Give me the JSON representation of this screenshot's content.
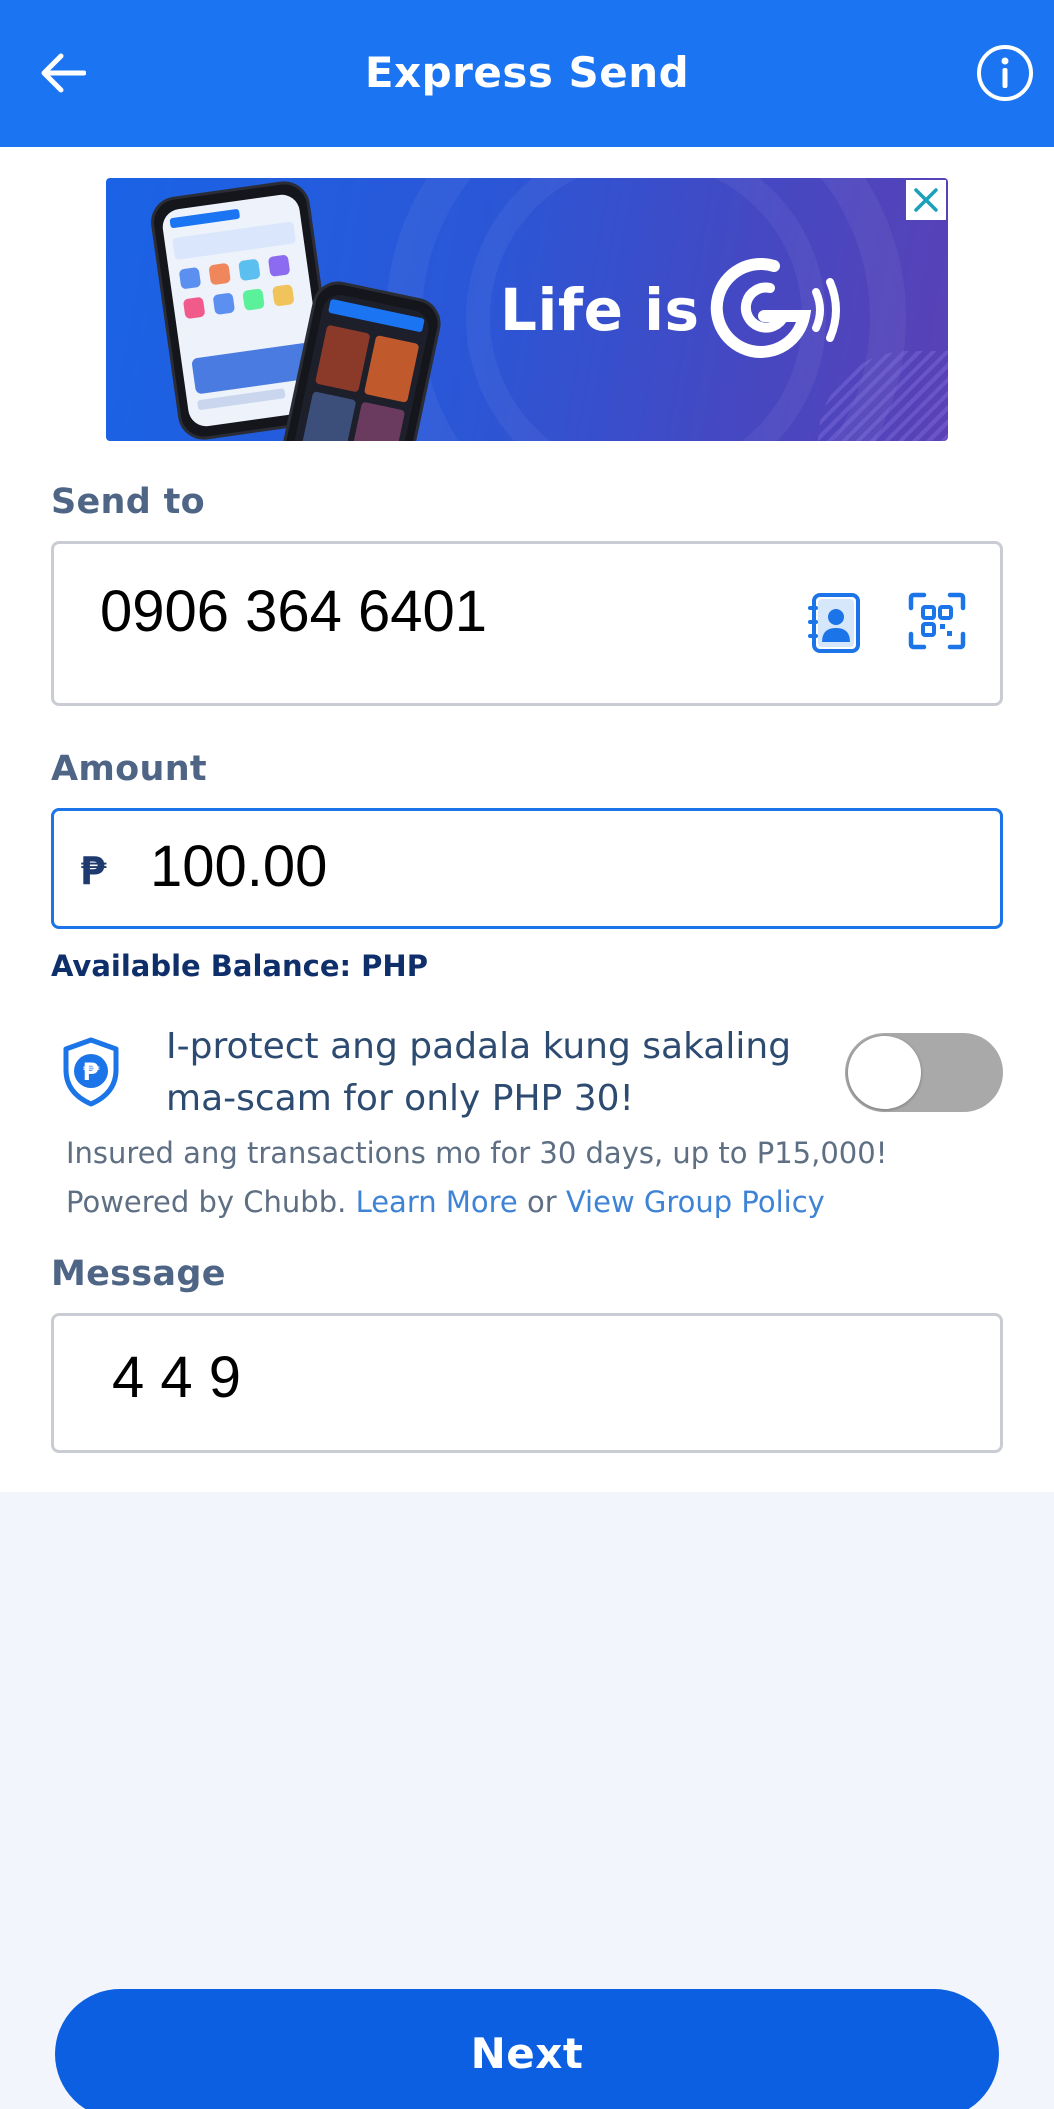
{
  "header": {
    "title": "Express Send",
    "back_icon": "arrow-left-icon",
    "info_icon": "info-circle-icon",
    "color": "#1b74f2"
  },
  "banner": {
    "tagline": "Life is",
    "logo": "gcash-g-logo",
    "close_icon": "close-icon"
  },
  "send_to": {
    "label": "Send to",
    "value": "0906 364 6401",
    "contacts_icon": "contacts-book-icon",
    "qr_icon": "qr-scan-icon"
  },
  "amount": {
    "label": "Amount",
    "currency_symbol": "₱",
    "value": "100.00"
  },
  "balance": {
    "text": "Available Balance: PHP"
  },
  "protect": {
    "icon": "peso-shield-icon",
    "text": "I-protect ang padala kung sakaling ma-scam for only PHP 30!",
    "toggle_on": false,
    "insured_text": "Insured ang transactions mo for 30 days, up to P15,000!",
    "powered_prefix": "Powered by Chubb.",
    "learn_more": "Learn More",
    "or_text": "or",
    "view_policy": "View Group Policy"
  },
  "message": {
    "label": "Message",
    "value": "4 4 9"
  },
  "footer": {
    "next_label": "Next",
    "button_color": "#0b5fe0"
  }
}
